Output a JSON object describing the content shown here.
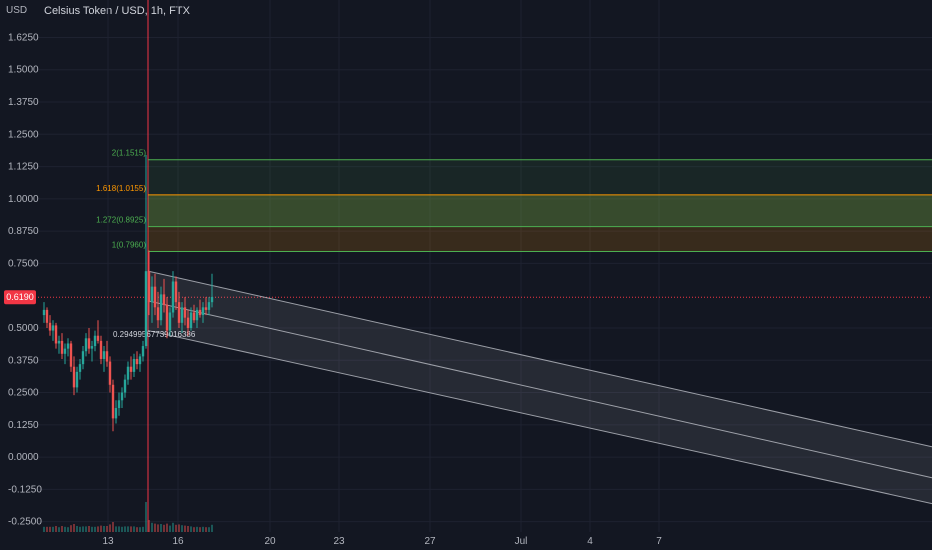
{
  "header": {
    "symbol_title": "Celsius Token / USD, 1h, FTX"
  },
  "price_axis": {
    "currency_label": "USD"
  },
  "last_price": {
    "value": 0.619,
    "label": "0.6190",
    "color": "#f23645"
  },
  "colors": {
    "background": "#131722",
    "grid": "#1e2230",
    "up": "#26a69a",
    "down": "#ef5350",
    "fib_green": "#4caf50",
    "fib_orange": "#ff9800",
    "channel_line": "#d1d4dc",
    "event_line": "#f23645"
  },
  "chart_data": {
    "type": "candlestick",
    "title": "Celsius Token / USD, 1h, FTX",
    "y_ticks": [
      1.625,
      1.5,
      1.375,
      1.25,
      1.125,
      1.0,
      0.875,
      0.75,
      0.5,
      0.375,
      0.25,
      0.125,
      0.0,
      -0.125,
      -0.25
    ],
    "y_tick_labels": [
      "1.6250",
      "1.5000",
      "1.3750",
      "1.2500",
      "1.1250",
      "1.0000",
      "0.8750",
      "0.7500",
      "0.5000",
      "0.3750",
      "0.2500",
      "0.1250",
      "0.0000",
      "-0.1250",
      "-0.2500"
    ],
    "ylim": [
      -0.29,
      1.77
    ],
    "x_ticks": [
      "13",
      "16",
      "20",
      "23",
      "27",
      "Jul",
      "4",
      "7"
    ],
    "fib_extension": {
      "levels": [
        {
          "ratio": "2",
          "price": 1.1515,
          "label": "2(1.1515)",
          "color": "#4caf50"
        },
        {
          "ratio": "1.618",
          "price": 1.0155,
          "label": "1.618(1.0155)",
          "color": "#ff9800"
        },
        {
          "ratio": "1.272",
          "price": 0.8925,
          "label": "1.272(0.8925)",
          "color": "#4caf50"
        },
        {
          "ratio": "1",
          "price": 0.796,
          "label": "1(0.7960)",
          "color": "#4caf50"
        }
      ]
    },
    "channel_annotation": "0.29499567739016386",
    "candles": [
      {
        "o": 0.55,
        "h": 0.6,
        "l": 0.52,
        "c": 0.57
      },
      {
        "o": 0.57,
        "h": 0.58,
        "l": 0.5,
        "c": 0.52
      },
      {
        "o": 0.52,
        "h": 0.55,
        "l": 0.47,
        "c": 0.49
      },
      {
        "o": 0.49,
        "h": 0.53,
        "l": 0.45,
        "c": 0.51
      },
      {
        "o": 0.51,
        "h": 0.52,
        "l": 0.42,
        "c": 0.44
      },
      {
        "o": 0.44,
        "h": 0.47,
        "l": 0.4,
        "c": 0.45
      },
      {
        "o": 0.45,
        "h": 0.48,
        "l": 0.38,
        "c": 0.4
      },
      {
        "o": 0.4,
        "h": 0.44,
        "l": 0.36,
        "c": 0.42
      },
      {
        "o": 0.42,
        "h": 0.46,
        "l": 0.39,
        "c": 0.44
      },
      {
        "o": 0.44,
        "h": 0.45,
        "l": 0.33,
        "c": 0.35
      },
      {
        "o": 0.35,
        "h": 0.39,
        "l": 0.24,
        "c": 0.27
      },
      {
        "o": 0.27,
        "h": 0.35,
        "l": 0.25,
        "c": 0.33
      },
      {
        "o": 0.33,
        "h": 0.38,
        "l": 0.3,
        "c": 0.36
      },
      {
        "o": 0.36,
        "h": 0.43,
        "l": 0.34,
        "c": 0.41
      },
      {
        "o": 0.41,
        "h": 0.48,
        "l": 0.39,
        "c": 0.46
      },
      {
        "o": 0.46,
        "h": 0.5,
        "l": 0.4,
        "c": 0.42
      },
      {
        "o": 0.42,
        "h": 0.45,
        "l": 0.37,
        "c": 0.43
      },
      {
        "o": 0.43,
        "h": 0.49,
        "l": 0.41,
        "c": 0.47
      },
      {
        "o": 0.47,
        "h": 0.53,
        "l": 0.44,
        "c": 0.45
      },
      {
        "o": 0.45,
        "h": 0.47,
        "l": 0.36,
        "c": 0.38
      },
      {
        "o": 0.38,
        "h": 0.43,
        "l": 0.33,
        "c": 0.41
      },
      {
        "o": 0.41,
        "h": 0.45,
        "l": 0.35,
        "c": 0.37
      },
      {
        "o": 0.37,
        "h": 0.39,
        "l": 0.25,
        "c": 0.28
      },
      {
        "o": 0.28,
        "h": 0.3,
        "l": 0.1,
        "c": 0.15
      },
      {
        "o": 0.15,
        "h": 0.22,
        "l": 0.13,
        "c": 0.19
      },
      {
        "o": 0.19,
        "h": 0.25,
        "l": 0.16,
        "c": 0.22
      },
      {
        "o": 0.22,
        "h": 0.27,
        "l": 0.19,
        "c": 0.25
      },
      {
        "o": 0.25,
        "h": 0.32,
        "l": 0.23,
        "c": 0.3
      },
      {
        "o": 0.3,
        "h": 0.37,
        "l": 0.28,
        "c": 0.35
      },
      {
        "o": 0.35,
        "h": 0.39,
        "l": 0.3,
        "c": 0.33
      },
      {
        "o": 0.33,
        "h": 0.4,
        "l": 0.31,
        "c": 0.38
      },
      {
        "o": 0.38,
        "h": 0.41,
        "l": 0.34,
        "c": 0.36
      },
      {
        "o": 0.36,
        "h": 0.4,
        "l": 0.33,
        "c": 0.39
      },
      {
        "o": 0.39,
        "h": 0.45,
        "l": 0.37,
        "c": 0.43
      },
      {
        "o": 0.43,
        "h": 1.17,
        "l": 0.42,
        "c": 0.72
      },
      {
        "o": 0.72,
        "h": 0.8,
        "l": 0.55,
        "c": 0.6
      },
      {
        "o": 0.6,
        "h": 0.7,
        "l": 0.52,
        "c": 0.66
      },
      {
        "o": 0.66,
        "h": 0.71,
        "l": 0.55,
        "c": 0.58
      },
      {
        "o": 0.58,
        "h": 0.64,
        "l": 0.5,
        "c": 0.53
      },
      {
        "o": 0.53,
        "h": 0.66,
        "l": 0.51,
        "c": 0.63
      },
      {
        "o": 0.63,
        "h": 0.69,
        "l": 0.56,
        "c": 0.59
      },
      {
        "o": 0.59,
        "h": 0.62,
        "l": 0.46,
        "c": 0.49
      },
      {
        "o": 0.49,
        "h": 0.58,
        "l": 0.47,
        "c": 0.56
      },
      {
        "o": 0.56,
        "h": 0.72,
        "l": 0.54,
        "c": 0.68
      },
      {
        "o": 0.68,
        "h": 0.7,
        "l": 0.57,
        "c": 0.6
      },
      {
        "o": 0.6,
        "h": 0.64,
        "l": 0.5,
        "c": 0.52
      },
      {
        "o": 0.52,
        "h": 0.6,
        "l": 0.48,
        "c": 0.58
      },
      {
        "o": 0.58,
        "h": 0.62,
        "l": 0.51,
        "c": 0.54
      },
      {
        "o": 0.54,
        "h": 0.57,
        "l": 0.47,
        "c": 0.5
      },
      {
        "o": 0.5,
        "h": 0.58,
        "l": 0.49,
        "c": 0.56
      },
      {
        "o": 0.56,
        "h": 0.59,
        "l": 0.52,
        "c": 0.53
      },
      {
        "o": 0.53,
        "h": 0.58,
        "l": 0.5,
        "c": 0.57
      },
      {
        "o": 0.57,
        "h": 0.61,
        "l": 0.54,
        "c": 0.55
      },
      {
        "o": 0.55,
        "h": 0.6,
        "l": 0.52,
        "c": 0.58
      },
      {
        "o": 0.58,
        "h": 0.62,
        "l": 0.55,
        "c": 0.57
      },
      {
        "o": 0.57,
        "h": 0.62,
        "l": 0.55,
        "c": 0.6
      },
      {
        "o": 0.6,
        "h": 0.71,
        "l": 0.58,
        "c": 0.62
      }
    ]
  }
}
